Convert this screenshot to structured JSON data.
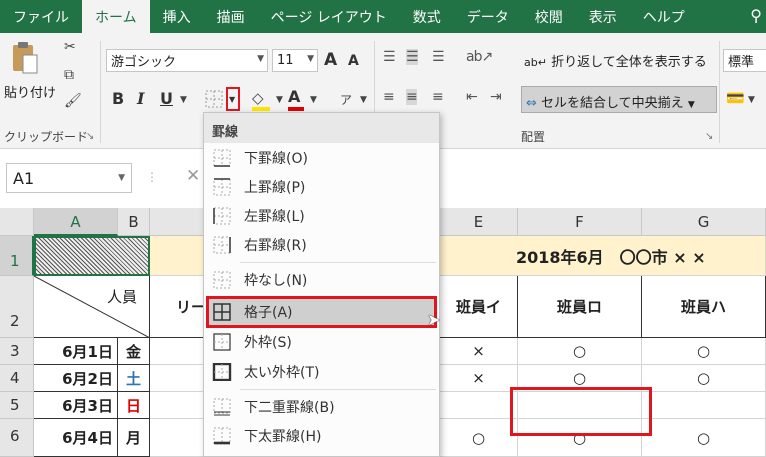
{
  "tabs": [
    "ファイル",
    "ホーム",
    "挿入",
    "描画",
    "ページ レイアウト",
    "数式",
    "データ",
    "校閲",
    "表示",
    "ヘルプ"
  ],
  "active_tab": "ホーム",
  "clipboard": {
    "paste": "貼り付け",
    "group_label": "クリップボード"
  },
  "font": {
    "name": "游ゴシック",
    "size": "11",
    "grow": "A",
    "shrink": "A",
    "bold": "B",
    "italic": "I",
    "underline": "U"
  },
  "alignment": {
    "wrap_text": "折り返して全体を表示する",
    "merge_center": "セルを結合して中央揃え",
    "group_label": "配置"
  },
  "number": {
    "format": "標準"
  },
  "name_box": "A1",
  "fx_label": "✕",
  "columns": [
    "A",
    "B",
    "E",
    "F",
    "G"
  ],
  "rows": [
    "1",
    "2",
    "3",
    "4",
    "5",
    "6"
  ],
  "title_cell": "2018年6月　〇〇市 × ×",
  "header_person": "人員",
  "header_cells": [
    "リー",
    "班員イ",
    "班員ロ",
    "班員ハ"
  ],
  "dates": [
    {
      "date": "6月1日",
      "day": "金"
    },
    {
      "date": "6月2日",
      "day": "土"
    },
    {
      "date": "6月3日",
      "day": "日"
    },
    {
      "date": "6月4日",
      "day": "月"
    }
  ],
  "marks": {
    "row3": [
      "×",
      "○",
      "○"
    ],
    "row4": [
      "×",
      "○",
      "○"
    ],
    "row6": [
      "○",
      "○",
      "○"
    ]
  },
  "border_menu": {
    "heading": "罫線",
    "items": [
      "下罫線(O)",
      "上罫線(P)",
      "左罫線(L)",
      "右罫線(R)",
      "枠なし(N)",
      "格子(A)",
      "外枠(S)",
      "太い外枠(T)",
      "下二重罫線(B)",
      "下太罫線(H)"
    ],
    "selected": "格子(A)"
  },
  "colors": {
    "excel_green": "#217346",
    "highlight_red": "#e0161e",
    "title_fill": "#fff2cc"
  }
}
